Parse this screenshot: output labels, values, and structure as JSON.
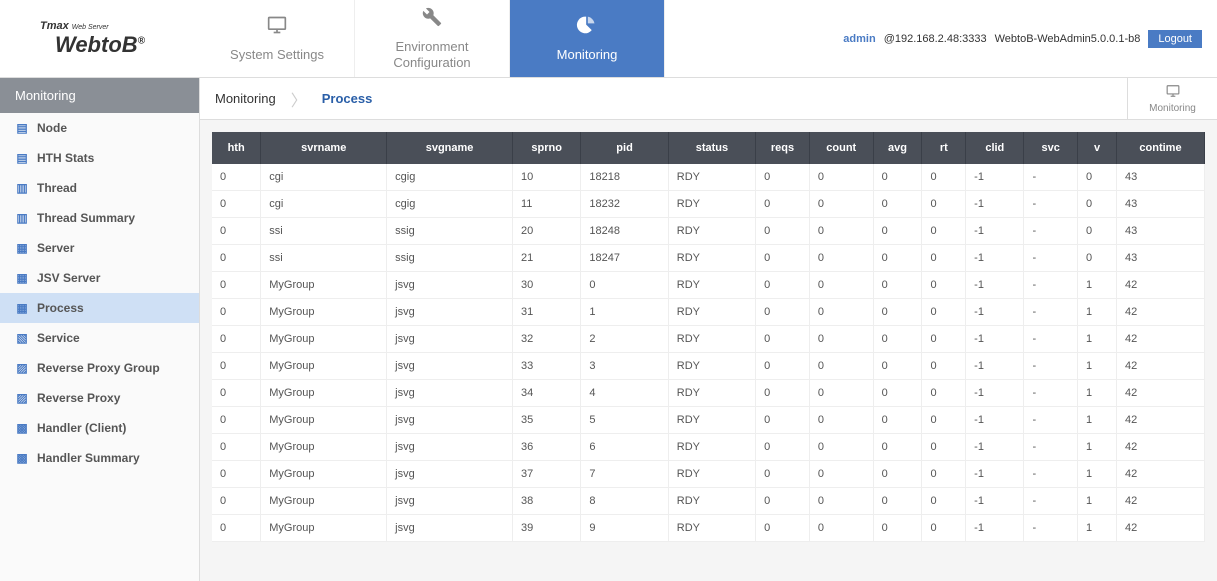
{
  "logo": {
    "brand": "Tmax",
    "brand_sub": "Web Server",
    "product": "WebtoB",
    "reg": "®"
  },
  "tabs": [
    {
      "label": "System Settings",
      "active": false
    },
    {
      "label": "Environment\nConfiguration",
      "active": false
    },
    {
      "label": "Monitoring",
      "active": true
    }
  ],
  "header_right": {
    "admin": "admin",
    "at": "@192.168.2.48:3333",
    "version": "WebtoB-WebAdmin5.0.0.1-b8",
    "logout": "Logout"
  },
  "sidebar": {
    "title": "Monitoring",
    "items": [
      {
        "label": "Node",
        "active": false
      },
      {
        "label": "HTH Stats",
        "active": false
      },
      {
        "label": "Thread",
        "active": false
      },
      {
        "label": "Thread Summary",
        "active": false
      },
      {
        "label": "Server",
        "active": false
      },
      {
        "label": "JSV Server",
        "active": false
      },
      {
        "label": "Process",
        "active": true
      },
      {
        "label": "Service",
        "active": false
      },
      {
        "label": "Reverse Proxy Group",
        "active": false
      },
      {
        "label": "Reverse Proxy",
        "active": false
      },
      {
        "label": "Handler (Client)",
        "active": false
      },
      {
        "label": "Handler Summary",
        "active": false
      }
    ]
  },
  "breadcrumb": {
    "root": "Monitoring",
    "current": "Process",
    "badge": "Monitoring"
  },
  "table": {
    "columns": [
      "hth",
      "svrname",
      "svgname",
      "sprno",
      "pid",
      "status",
      "reqs",
      "count",
      "avg",
      "rt",
      "clid",
      "svc",
      "v",
      "contime"
    ],
    "rows": [
      [
        "0",
        "cgi",
        "cgig",
        "10",
        "18218",
        "RDY",
        "0",
        "0",
        "0",
        "0",
        "-1",
        "-",
        "0",
        "43"
      ],
      [
        "0",
        "cgi",
        "cgig",
        "11",
        "18232",
        "RDY",
        "0",
        "0",
        "0",
        "0",
        "-1",
        "-",
        "0",
        "43"
      ],
      [
        "0",
        "ssi",
        "ssig",
        "20",
        "18248",
        "RDY",
        "0",
        "0",
        "0",
        "0",
        "-1",
        "-",
        "0",
        "43"
      ],
      [
        "0",
        "ssi",
        "ssig",
        "21",
        "18247",
        "RDY",
        "0",
        "0",
        "0",
        "0",
        "-1",
        "-",
        "0",
        "43"
      ],
      [
        "0",
        "MyGroup",
        "jsvg",
        "30",
        "0",
        "RDY",
        "0",
        "0",
        "0",
        "0",
        "-1",
        "-",
        "1",
        "42"
      ],
      [
        "0",
        "MyGroup",
        "jsvg",
        "31",
        "1",
        "RDY",
        "0",
        "0",
        "0",
        "0",
        "-1",
        "-",
        "1",
        "42"
      ],
      [
        "0",
        "MyGroup",
        "jsvg",
        "32",
        "2",
        "RDY",
        "0",
        "0",
        "0",
        "0",
        "-1",
        "-",
        "1",
        "42"
      ],
      [
        "0",
        "MyGroup",
        "jsvg",
        "33",
        "3",
        "RDY",
        "0",
        "0",
        "0",
        "0",
        "-1",
        "-",
        "1",
        "42"
      ],
      [
        "0",
        "MyGroup",
        "jsvg",
        "34",
        "4",
        "RDY",
        "0",
        "0",
        "0",
        "0",
        "-1",
        "-",
        "1",
        "42"
      ],
      [
        "0",
        "MyGroup",
        "jsvg",
        "35",
        "5",
        "RDY",
        "0",
        "0",
        "0",
        "0",
        "-1",
        "-",
        "1",
        "42"
      ],
      [
        "0",
        "MyGroup",
        "jsvg",
        "36",
        "6",
        "RDY",
        "0",
        "0",
        "0",
        "0",
        "-1",
        "-",
        "1",
        "42"
      ],
      [
        "0",
        "MyGroup",
        "jsvg",
        "37",
        "7",
        "RDY",
        "0",
        "0",
        "0",
        "0",
        "-1",
        "-",
        "1",
        "42"
      ],
      [
        "0",
        "MyGroup",
        "jsvg",
        "38",
        "8",
        "RDY",
        "0",
        "0",
        "0",
        "0",
        "-1",
        "-",
        "1",
        "42"
      ],
      [
        "0",
        "MyGroup",
        "jsvg",
        "39",
        "9",
        "RDY",
        "0",
        "0",
        "0",
        "0",
        "-1",
        "-",
        "1",
        "42"
      ]
    ]
  }
}
